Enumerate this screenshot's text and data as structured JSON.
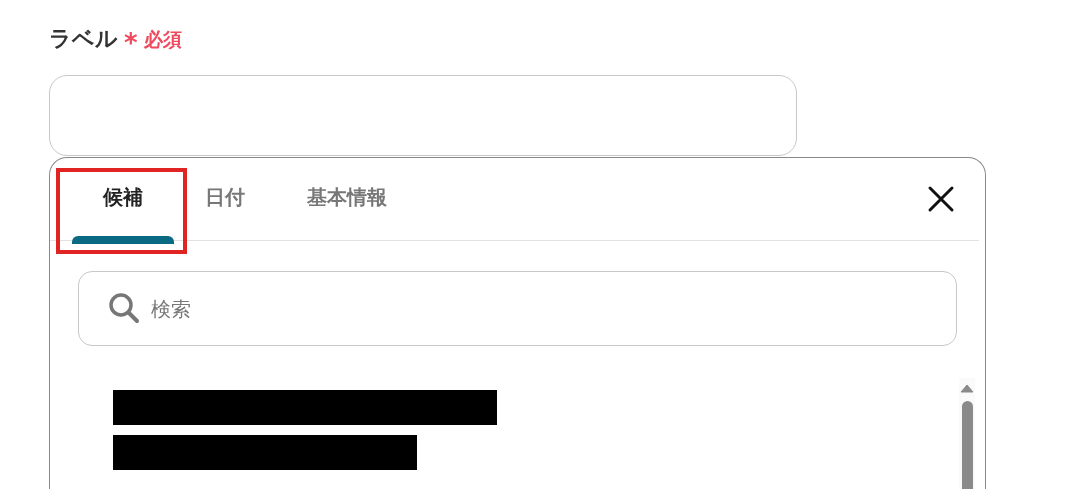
{
  "field": {
    "label": "ラベル",
    "required_mark": "*",
    "required_text": "必須"
  },
  "popup": {
    "tabs": [
      {
        "label": "候補",
        "selected": true,
        "highlighted": true
      },
      {
        "label": "日付",
        "selected": false,
        "highlighted": false
      },
      {
        "label": "基本情報",
        "selected": false,
        "highlighted": false
      }
    ],
    "search": {
      "placeholder": "検索"
    },
    "results": [
      {
        "kind": "redacted"
      },
      {
        "kind": "redacted"
      }
    ]
  }
}
